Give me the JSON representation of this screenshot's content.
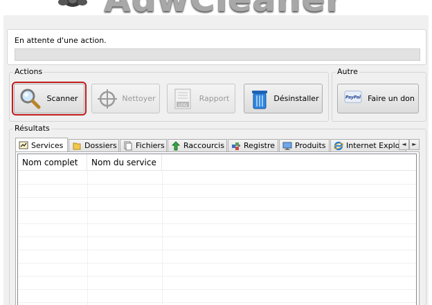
{
  "status": {
    "message": "En attente d'une action.",
    "progress_percent": 0
  },
  "groups": {
    "actions": "Actions",
    "autre": "Autre",
    "results": "Résultats"
  },
  "buttons": {
    "scanner": "Scanner",
    "nettoyer": "Nettoyer",
    "rapport": "Rapport",
    "desinstaller": "Désinstaller",
    "don": "Faire un don",
    "paypal_logo": "PayPal"
  },
  "tabs": [
    {
      "label": "Services",
      "icon": "services-icon",
      "active": true
    },
    {
      "label": "Dossiers",
      "icon": "folder-icon"
    },
    {
      "label": "Fichiers",
      "icon": "files-icon"
    },
    {
      "label": "Raccourcis",
      "icon": "shortcut-arrow-icon"
    },
    {
      "label": "Registre",
      "icon": "registry-icon"
    },
    {
      "label": "Produits",
      "icon": "monitor-icon"
    },
    {
      "label": "Internet Explor",
      "icon": "internet-explorer-icon"
    }
  ],
  "tab_scroll": {
    "left": "◄",
    "right": "►"
  },
  "list": {
    "columns": [
      "Nom complet",
      "Nom du service"
    ]
  },
  "colors": {
    "focus_outline": "#c11b1b",
    "progress_fill": "#4fbb4f"
  }
}
